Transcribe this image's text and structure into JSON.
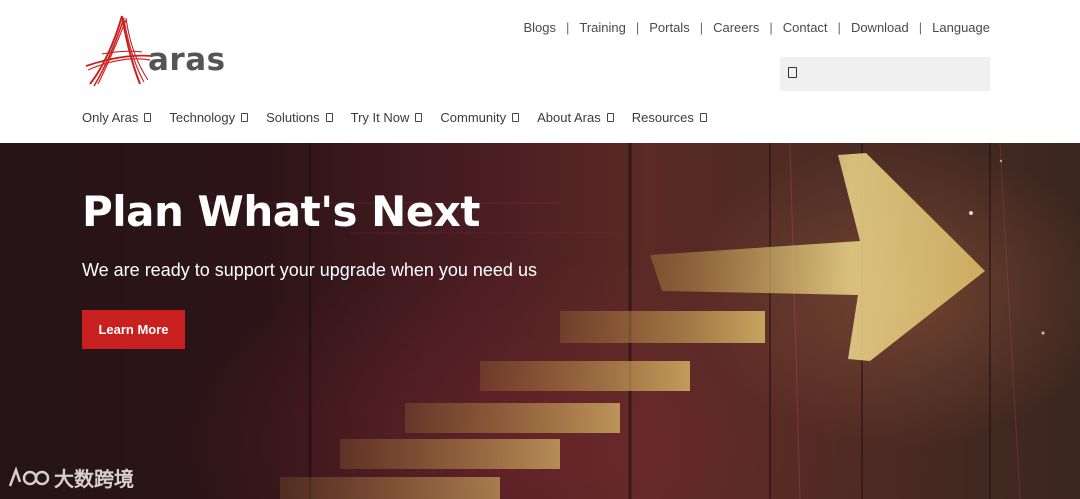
{
  "brand": {
    "name": "aras",
    "accent_color": "#c8201f"
  },
  "utility_nav": {
    "items": [
      "Blogs",
      "Training",
      "Portals",
      "Careers",
      "Contact",
      "Download",
      "Language"
    ],
    "separator": "|"
  },
  "search": {
    "value": "",
    "icon": "search-icon"
  },
  "main_nav": {
    "items": [
      "Only Aras",
      "Technology",
      "Solutions",
      "Try It Now",
      "Community",
      "About Aras",
      "Resources"
    ]
  },
  "hero": {
    "title": "Plan What's Next",
    "subtitle": "We are ready to support your upgrade when you need us",
    "button_label": "Learn More",
    "button_color": "#c8201f"
  },
  "watermark": {
    "text": "大数跨境"
  }
}
